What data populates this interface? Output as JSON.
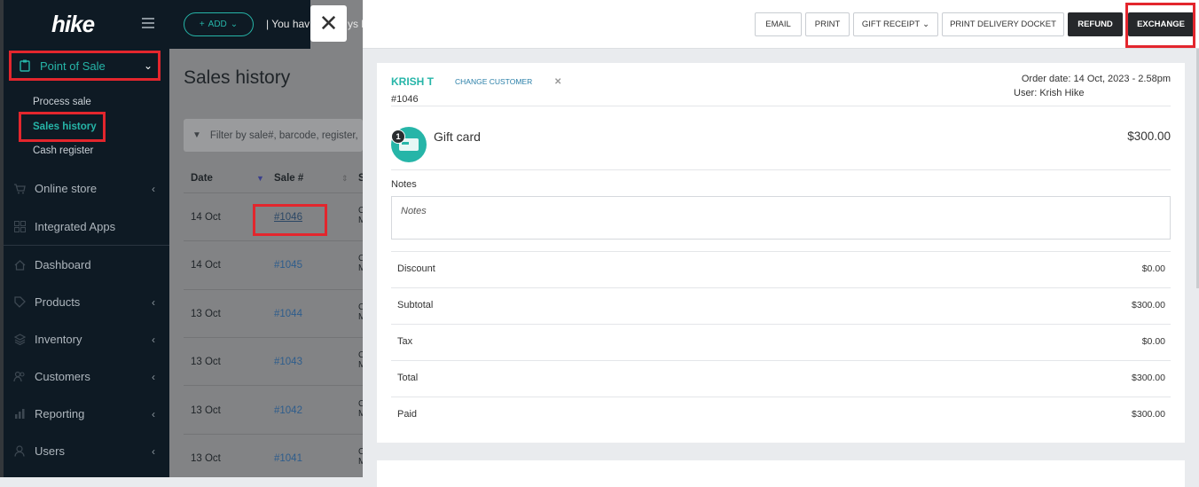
{
  "app": {
    "logo": "hike"
  },
  "sidebar": {
    "active_section": "Point of Sale",
    "sub_items": [
      "Process sale",
      "Sales history",
      "Cash register"
    ],
    "items": [
      {
        "label": "Online store",
        "icon": "cart-icon",
        "chevron": true
      },
      {
        "label": "Integrated Apps",
        "icon": "grid-icon",
        "chevron": false
      },
      {
        "label": "Dashboard",
        "icon": "home-icon",
        "chevron": false
      },
      {
        "label": "Products",
        "icon": "tag-icon",
        "chevron": true
      },
      {
        "label": "Inventory",
        "icon": "layers-icon",
        "chevron": true
      },
      {
        "label": "Customers",
        "icon": "users-icon",
        "chevron": true
      },
      {
        "label": "Reporting",
        "icon": "bar-chart-icon",
        "chevron": true
      },
      {
        "label": "Users",
        "icon": "user-icon",
        "chevron": true
      }
    ]
  },
  "list_page": {
    "add_label": "ADD",
    "notice": "You hav",
    "notice_tail": "ys le",
    "title": "Sales history",
    "filter_placeholder": "Filter by sale#, barcode, register,",
    "columns": [
      "Date",
      "Sale #",
      "S"
    ],
    "rows": [
      {
        "date": "14 Oct",
        "sale": "#1046"
      },
      {
        "date": "14 Oct",
        "sale": "#1045"
      },
      {
        "date": "13 Oct",
        "sale": "#1044"
      },
      {
        "date": "13 Oct",
        "sale": "#1043"
      },
      {
        "date": "13 Oct",
        "sale": "#1042"
      },
      {
        "date": "13 Oct",
        "sale": "#1041"
      }
    ]
  },
  "panel": {
    "buttons": {
      "email": "EMAIL",
      "print": "PRINT",
      "gift_receipt": "GIFT RECEIPT",
      "print_delivery": "PRINT DELIVERY DOCKET",
      "refund": "REFUND",
      "exchange": "EXCHANGE"
    },
    "customer_name": "KRISH T",
    "change_customer": "CHANGE CUSTOMER",
    "sale_number": "#1046",
    "order_date": "Order date: 14 Oct, 2023 - 2.58pm",
    "user": "User: Krish Hike",
    "item": {
      "qty": "1",
      "name": "Gift card",
      "price": "$300.00"
    },
    "notes_label": "Notes",
    "notes_placeholder": "Notes",
    "summary": [
      {
        "label": "Discount",
        "value": "$0.00"
      },
      {
        "label": "Subtotal",
        "value": "$300.00"
      },
      {
        "label": "Tax",
        "value": "$0.00"
      },
      {
        "label": "Total",
        "value": "$300.00"
      },
      {
        "label": "Paid",
        "value": "$300.00"
      }
    ]
  },
  "colors": {
    "accent": "#26b5a8",
    "highlight": "#e3262d",
    "sidebar_bg": "#0e1a24",
    "dark_button": "#26282b"
  }
}
